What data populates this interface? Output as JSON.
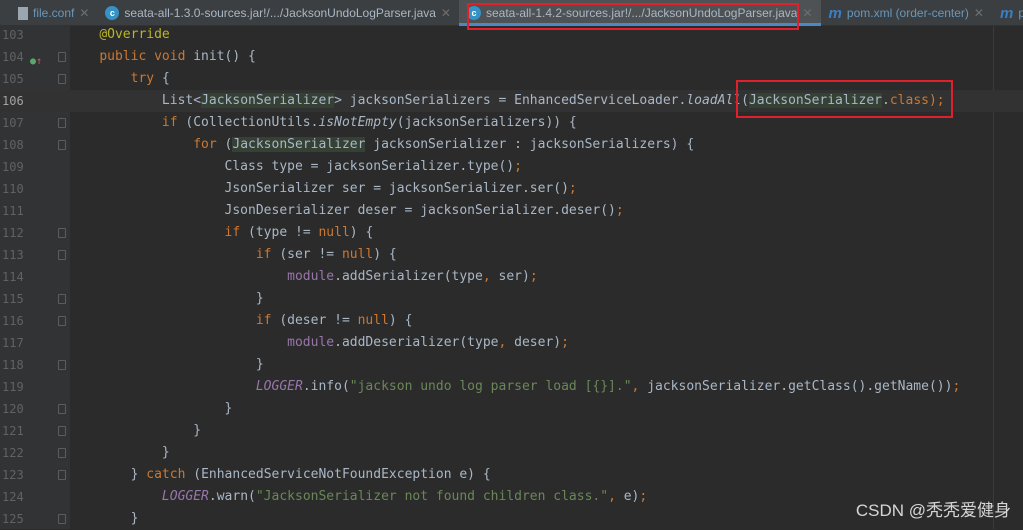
{
  "tabs": [
    {
      "label": "file.conf",
      "icon": "file-icon",
      "active": false
    },
    {
      "label": "seata-all-1.3.0-sources.jar!/.../JacksonUndoLogParser.java",
      "icon": "java-class-icon",
      "active": false
    },
    {
      "label": "seata-all-1.4.2-sources.jar!/.../JacksonUndoLogParser.java",
      "icon": "java-class-icon",
      "active": true
    },
    {
      "label": "pom.xml (order-center)",
      "icon": "maven-icon",
      "active": false
    },
    {
      "label": "pom",
      "icon": "maven-icon",
      "active": false
    }
  ],
  "current_line": "106",
  "lines": [
    {
      "n": "103",
      "t": [
        [
          "    ",
          ""
        ],
        [
          "@Override",
          "ann"
        ]
      ]
    },
    {
      "n": "104",
      "fold": true,
      "marker": true,
      "t": [
        [
          "    ",
          ""
        ],
        [
          "public void ",
          "kw"
        ],
        [
          "init",
          ""
        ],
        [
          "() {",
          ""
        ]
      ]
    },
    {
      "n": "105",
      "fold": true,
      "t": [
        [
          "        ",
          ""
        ],
        [
          "try ",
          "kw"
        ],
        [
          "{",
          ""
        ]
      ]
    },
    {
      "n": "106",
      "t": [
        [
          "            List<",
          ""
        ],
        [
          "JacksonSerializer",
          "hl"
        ],
        [
          "> jacksonSerializers = EnhancedServiceLoader.",
          ""
        ],
        [
          "loadAll",
          "it"
        ],
        [
          "(",
          ""
        ],
        [
          "JacksonSerializer",
          "hl"
        ],
        [
          ".",
          ""
        ],
        [
          "class",
          "kw"
        ],
        [
          ");",
          "kw"
        ]
      ]
    },
    {
      "n": "107",
      "fold": true,
      "t": [
        [
          "            ",
          ""
        ],
        [
          "if ",
          "kw"
        ],
        [
          "(CollectionUtils.",
          ""
        ],
        [
          "isNotEmpty",
          "it"
        ],
        [
          "(jacksonSerializers)) {",
          ""
        ]
      ]
    },
    {
      "n": "108",
      "fold": true,
      "t": [
        [
          "                ",
          ""
        ],
        [
          "for ",
          "kw"
        ],
        [
          "(",
          ""
        ],
        [
          "JacksonSerializer",
          "hl"
        ],
        [
          " jacksonSerializer : jacksonSerializers) {",
          ""
        ]
      ]
    },
    {
      "n": "109",
      "t": [
        [
          "                    Class type = jacksonSerializer.type()",
          ""
        ],
        [
          ";",
          "kw"
        ]
      ]
    },
    {
      "n": "110",
      "t": [
        [
          "                    JsonSerializer ser = jacksonSerializer.ser()",
          ""
        ],
        [
          ";",
          "kw"
        ]
      ]
    },
    {
      "n": "111",
      "t": [
        [
          "                    JsonDeserializer deser = jacksonSerializer.deser()",
          ""
        ],
        [
          ";",
          "kw"
        ]
      ]
    },
    {
      "n": "112",
      "fold": true,
      "t": [
        [
          "                    ",
          ""
        ],
        [
          "if ",
          "kw"
        ],
        [
          "(type != ",
          ""
        ],
        [
          "null",
          "kw"
        ],
        [
          ") {",
          ""
        ]
      ]
    },
    {
      "n": "113",
      "fold": true,
      "t": [
        [
          "                        ",
          ""
        ],
        [
          "if ",
          "kw"
        ],
        [
          "(ser != ",
          ""
        ],
        [
          "null",
          "kw"
        ],
        [
          ") {",
          ""
        ]
      ]
    },
    {
      "n": "114",
      "t": [
        [
          "                            ",
          ""
        ],
        [
          "module",
          "mem"
        ],
        [
          ".addSerializer(type",
          ""
        ],
        [
          ", ",
          "kw"
        ],
        [
          "ser)",
          ""
        ],
        [
          ";",
          "kw"
        ]
      ]
    },
    {
      "n": "115",
      "fold": true,
      "t": [
        [
          "                        }",
          ""
        ]
      ]
    },
    {
      "n": "116",
      "fold": true,
      "t": [
        [
          "                        ",
          ""
        ],
        [
          "if ",
          "kw"
        ],
        [
          "(deser != ",
          ""
        ],
        [
          "null",
          "kw"
        ],
        [
          ") {",
          ""
        ]
      ]
    },
    {
      "n": "117",
      "t": [
        [
          "                            ",
          ""
        ],
        [
          "module",
          "mem"
        ],
        [
          ".addDeserializer(type",
          ""
        ],
        [
          ", ",
          "kw"
        ],
        [
          "deser)",
          ""
        ],
        [
          ";",
          "kw"
        ]
      ]
    },
    {
      "n": "118",
      "fold": true,
      "t": [
        [
          "                        }",
          ""
        ]
      ]
    },
    {
      "n": "119",
      "t": [
        [
          "                        ",
          ""
        ],
        [
          "LOGGER",
          "fld"
        ],
        [
          ".info(",
          ""
        ],
        [
          "\"jackson undo log parser load [{}].\"",
          "str"
        ],
        [
          ", ",
          "kw"
        ],
        [
          "jacksonSerializer.getClass().getName())",
          ""
        ],
        [
          ";",
          "kw"
        ]
      ]
    },
    {
      "n": "120",
      "fold": true,
      "t": [
        [
          "                    }",
          ""
        ]
      ]
    },
    {
      "n": "121",
      "fold": true,
      "t": [
        [
          "                }",
          ""
        ]
      ]
    },
    {
      "n": "122",
      "fold": true,
      "t": [
        [
          "            }",
          ""
        ]
      ]
    },
    {
      "n": "123",
      "fold": true,
      "t": [
        [
          "        } ",
          ""
        ],
        [
          "catch ",
          "kw"
        ],
        [
          "(EnhancedServiceNotFoundException e) {",
          ""
        ]
      ]
    },
    {
      "n": "124",
      "t": [
        [
          "            ",
          ""
        ],
        [
          "LOGGER",
          "fld"
        ],
        [
          ".warn(",
          ""
        ],
        [
          "\"JacksonSerializer not found children class.\"",
          "str"
        ],
        [
          ", ",
          "kw"
        ],
        [
          "e)",
          ""
        ],
        [
          ";",
          "kw"
        ]
      ]
    },
    {
      "n": "125",
      "fold": true,
      "t": [
        [
          "        }",
          ""
        ]
      ]
    }
  ],
  "watermark": "CSDN @秃秃爱健身",
  "colors": {
    "background": "#2b2b2b",
    "keyword": "#cc7832",
    "string": "#6a8759",
    "annotation": "#bbb529",
    "field": "#9876aa",
    "highlight_box": "#e0202a"
  }
}
